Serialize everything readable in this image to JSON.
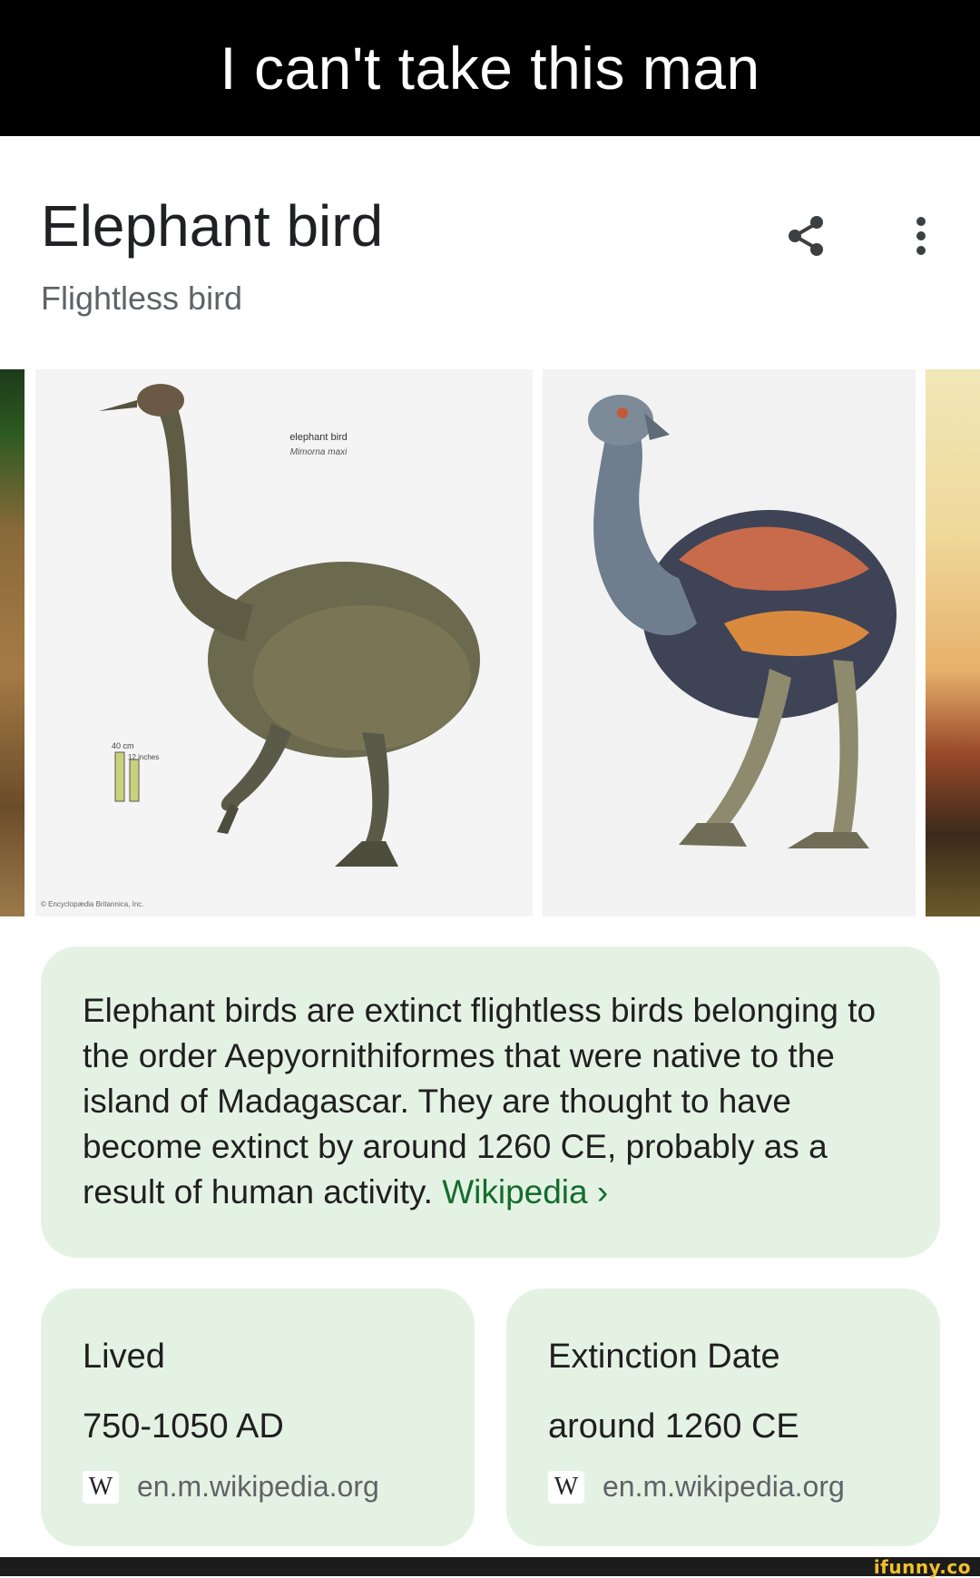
{
  "caption": "I can't take this man",
  "panel": {
    "title": "Elephant bird",
    "subtitle": "Flightless bird",
    "share_icon": "share-icon",
    "more_icon": "more-vertical-icon"
  },
  "images": [
    {
      "label": "elephant bird",
      "sublabel": "Mimorna maxi",
      "scale_label": "40 cm",
      "scale_label_2": "12 inches",
      "credit": "© Encyclopædia Britannica, Inc."
    },
    {}
  ],
  "description": {
    "text": "Elephant birds are extinct flightless birds belonging to the order Aepyornithiformes that were native to the island of Madagascar. They are thought to have become extinct by around 1260 CE, probably as a result of human activity. ",
    "link_label": "Wikipedia",
    "link_chevron": "›"
  },
  "facts": [
    {
      "label": "Lived",
      "value": "750-1050 AD",
      "source_badge": "W",
      "source": "en.m.wikipedia.org"
    },
    {
      "label": "Extinction Date",
      "value": "around 1260 CE",
      "source_badge": "W",
      "source": "en.m.wikipedia.org"
    }
  ],
  "watermark": "ifunny.co",
  "colors": {
    "card_bg": "#e4f2e3",
    "link": "#146c2e",
    "caption_bg": "#000000"
  }
}
